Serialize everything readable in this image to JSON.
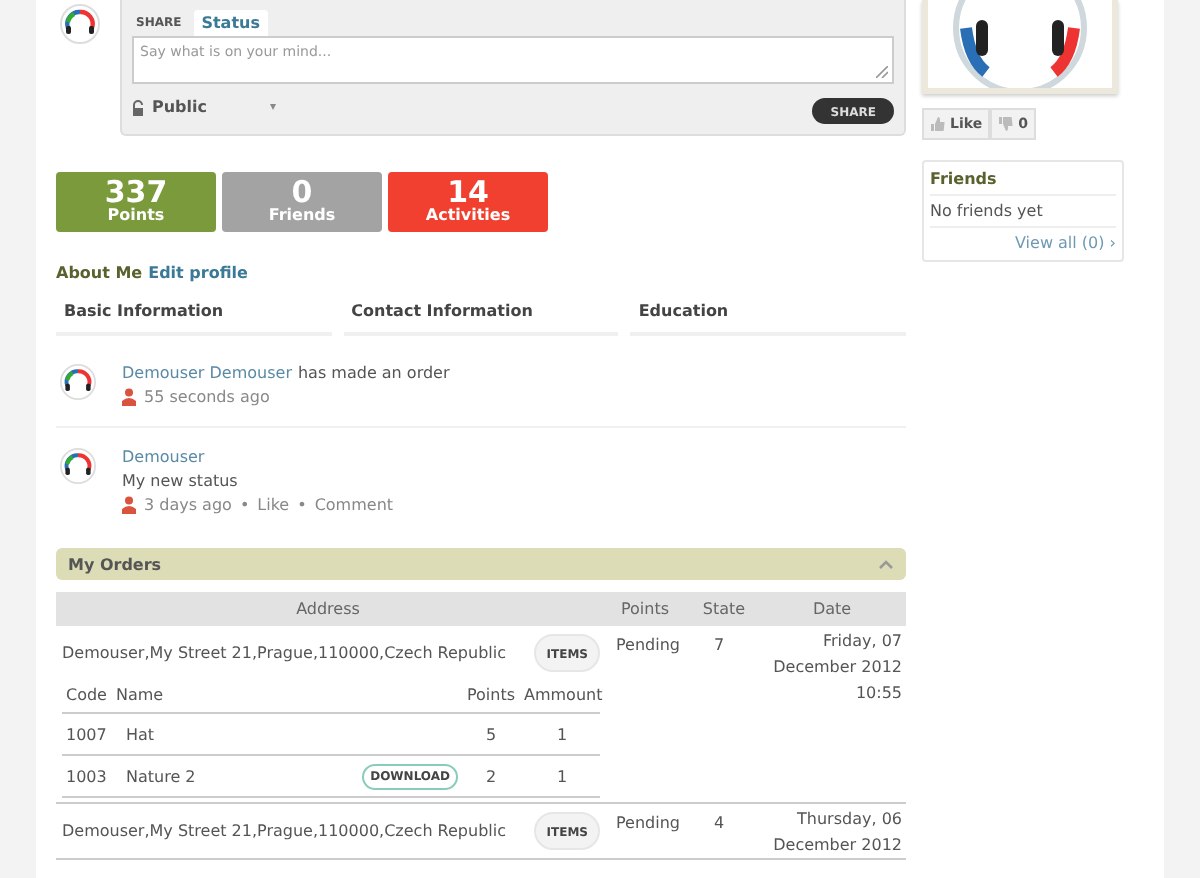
{
  "share": {
    "label": "SHARE",
    "tabs": [
      {
        "label": "Status",
        "selected": true
      }
    ],
    "placeholder": "Say what is on your mind...",
    "privacy": "Public",
    "caret": "▾",
    "button": "SHARE"
  },
  "stats": [
    {
      "value": "337",
      "label": "Points",
      "color": "#7b9a3c"
    },
    {
      "value": "0",
      "label": "Friends",
      "color": "#a3a3a3"
    },
    {
      "value": "14",
      "label": "Activities",
      "color": "#f1402f"
    }
  ],
  "like": {
    "label": "Like",
    "dislike_count": "0"
  },
  "friends": {
    "title": "Friends",
    "empty": "No friends yet",
    "link": "View all (0)",
    "arrow": "›"
  },
  "about": {
    "title": "About Me",
    "edit_link": "Edit profile",
    "sections": [
      "Basic Information",
      "Contact Information",
      "Education"
    ]
  },
  "separator": "•",
  "activities": [
    {
      "user": "Demouser Demouser",
      "text": "has made an order",
      "time": "55 seconds ago"
    },
    {
      "user": "Demouser",
      "status": "My new status",
      "time": "3 days ago",
      "actions": [
        "Like",
        "Comment"
      ]
    }
  ],
  "orders": {
    "title": "My Orders",
    "expanded": true,
    "columns": [
      "Address",
      "Points",
      "State",
      "Date"
    ],
    "rows": [
      {
        "address": "Demouser,My Street 21,Prague,110000,Czech Republic",
        "items_button": "ITEMS",
        "points": "Pending",
        "state": "7",
        "date": "Friday, 07 December 2012 10:55",
        "items": {
          "columns": [
            "Code",
            "Name",
            "Points",
            "Ammount"
          ],
          "rows": [
            {
              "code": "1007",
              "name": "Hat",
              "points": "5",
              "amount": "1"
            },
            {
              "code": "1003",
              "name": "Nature 2",
              "download": "DOWNLOAD",
              "points": "2",
              "amount": "1"
            }
          ]
        }
      },
      {
        "address": "Demouser,My Street 21,Prague,110000,Czech Republic",
        "items_button": "ITEMS",
        "points": "Pending",
        "state": "4",
        "date": "Thursday, 06 December 2012"
      }
    ]
  }
}
